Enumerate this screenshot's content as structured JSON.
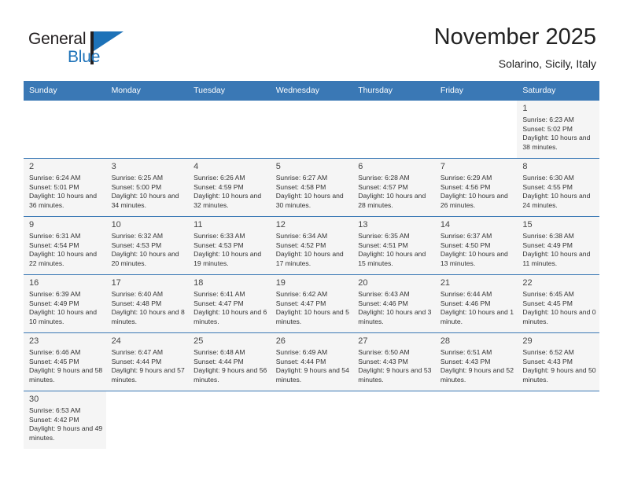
{
  "logo": {
    "word_top": "General",
    "word_bottom": "Blue",
    "brand_color": "#1d72b8",
    "text_color": "#231f20"
  },
  "header": {
    "title": "November 2025",
    "subtitle": "Solarino, Sicily, Italy"
  },
  "calendar": {
    "header_bg": "#3a78b5",
    "header_text_color": "#ffffff",
    "shaded_cell_bg": "#f5f5f5",
    "weekday_headers": [
      "Sunday",
      "Monday",
      "Tuesday",
      "Wednesday",
      "Thursday",
      "Friday",
      "Saturday"
    ],
    "weeks": [
      [
        {
          "day": "",
          "sunrise": "",
          "sunset": "",
          "daylight": "",
          "empty": true
        },
        {
          "day": "",
          "sunrise": "",
          "sunset": "",
          "daylight": "",
          "empty": true
        },
        {
          "day": "",
          "sunrise": "",
          "sunset": "",
          "daylight": "",
          "empty": true
        },
        {
          "day": "",
          "sunrise": "",
          "sunset": "",
          "daylight": "",
          "empty": true
        },
        {
          "day": "",
          "sunrise": "",
          "sunset": "",
          "daylight": "",
          "empty": true
        },
        {
          "day": "",
          "sunrise": "",
          "sunset": "",
          "daylight": "",
          "empty": true
        },
        {
          "day": "1",
          "sunrise": "Sunrise: 6:23 AM",
          "sunset": "Sunset: 5:02 PM",
          "daylight": "Daylight: 10 hours and 38 minutes.",
          "empty": false
        }
      ],
      [
        {
          "day": "2",
          "sunrise": "Sunrise: 6:24 AM",
          "sunset": "Sunset: 5:01 PM",
          "daylight": "Daylight: 10 hours and 36 minutes.",
          "empty": false
        },
        {
          "day": "3",
          "sunrise": "Sunrise: 6:25 AM",
          "sunset": "Sunset: 5:00 PM",
          "daylight": "Daylight: 10 hours and 34 minutes.",
          "empty": false
        },
        {
          "day": "4",
          "sunrise": "Sunrise: 6:26 AM",
          "sunset": "Sunset: 4:59 PM",
          "daylight": "Daylight: 10 hours and 32 minutes.",
          "empty": false
        },
        {
          "day": "5",
          "sunrise": "Sunrise: 6:27 AM",
          "sunset": "Sunset: 4:58 PM",
          "daylight": "Daylight: 10 hours and 30 minutes.",
          "empty": false
        },
        {
          "day": "6",
          "sunrise": "Sunrise: 6:28 AM",
          "sunset": "Sunset: 4:57 PM",
          "daylight": "Daylight: 10 hours and 28 minutes.",
          "empty": false
        },
        {
          "day": "7",
          "sunrise": "Sunrise: 6:29 AM",
          "sunset": "Sunset: 4:56 PM",
          "daylight": "Daylight: 10 hours and 26 minutes.",
          "empty": false
        },
        {
          "day": "8",
          "sunrise": "Sunrise: 6:30 AM",
          "sunset": "Sunset: 4:55 PM",
          "daylight": "Daylight: 10 hours and 24 minutes.",
          "empty": false
        }
      ],
      [
        {
          "day": "9",
          "sunrise": "Sunrise: 6:31 AM",
          "sunset": "Sunset: 4:54 PM",
          "daylight": "Daylight: 10 hours and 22 minutes.",
          "empty": false
        },
        {
          "day": "10",
          "sunrise": "Sunrise: 6:32 AM",
          "sunset": "Sunset: 4:53 PM",
          "daylight": "Daylight: 10 hours and 20 minutes.",
          "empty": false
        },
        {
          "day": "11",
          "sunrise": "Sunrise: 6:33 AM",
          "sunset": "Sunset: 4:53 PM",
          "daylight": "Daylight: 10 hours and 19 minutes.",
          "empty": false
        },
        {
          "day": "12",
          "sunrise": "Sunrise: 6:34 AM",
          "sunset": "Sunset: 4:52 PM",
          "daylight": "Daylight: 10 hours and 17 minutes.",
          "empty": false
        },
        {
          "day": "13",
          "sunrise": "Sunrise: 6:35 AM",
          "sunset": "Sunset: 4:51 PM",
          "daylight": "Daylight: 10 hours and 15 minutes.",
          "empty": false
        },
        {
          "day": "14",
          "sunrise": "Sunrise: 6:37 AM",
          "sunset": "Sunset: 4:50 PM",
          "daylight": "Daylight: 10 hours and 13 minutes.",
          "empty": false
        },
        {
          "day": "15",
          "sunrise": "Sunrise: 6:38 AM",
          "sunset": "Sunset: 4:49 PM",
          "daylight": "Daylight: 10 hours and 11 minutes.",
          "empty": false
        }
      ],
      [
        {
          "day": "16",
          "sunrise": "Sunrise: 6:39 AM",
          "sunset": "Sunset: 4:49 PM",
          "daylight": "Daylight: 10 hours and 10 minutes.",
          "empty": false
        },
        {
          "day": "17",
          "sunrise": "Sunrise: 6:40 AM",
          "sunset": "Sunset: 4:48 PM",
          "daylight": "Daylight: 10 hours and 8 minutes.",
          "empty": false
        },
        {
          "day": "18",
          "sunrise": "Sunrise: 6:41 AM",
          "sunset": "Sunset: 4:47 PM",
          "daylight": "Daylight: 10 hours and 6 minutes.",
          "empty": false
        },
        {
          "day": "19",
          "sunrise": "Sunrise: 6:42 AM",
          "sunset": "Sunset: 4:47 PM",
          "daylight": "Daylight: 10 hours and 5 minutes.",
          "empty": false
        },
        {
          "day": "20",
          "sunrise": "Sunrise: 6:43 AM",
          "sunset": "Sunset: 4:46 PM",
          "daylight": "Daylight: 10 hours and 3 minutes.",
          "empty": false
        },
        {
          "day": "21",
          "sunrise": "Sunrise: 6:44 AM",
          "sunset": "Sunset: 4:46 PM",
          "daylight": "Daylight: 10 hours and 1 minute.",
          "empty": false
        },
        {
          "day": "22",
          "sunrise": "Sunrise: 6:45 AM",
          "sunset": "Sunset: 4:45 PM",
          "daylight": "Daylight: 10 hours and 0 minutes.",
          "empty": false
        }
      ],
      [
        {
          "day": "23",
          "sunrise": "Sunrise: 6:46 AM",
          "sunset": "Sunset: 4:45 PM",
          "daylight": "Daylight: 9 hours and 58 minutes.",
          "empty": false
        },
        {
          "day": "24",
          "sunrise": "Sunrise: 6:47 AM",
          "sunset": "Sunset: 4:44 PM",
          "daylight": "Daylight: 9 hours and 57 minutes.",
          "empty": false
        },
        {
          "day": "25",
          "sunrise": "Sunrise: 6:48 AM",
          "sunset": "Sunset: 4:44 PM",
          "daylight": "Daylight: 9 hours and 56 minutes.",
          "empty": false
        },
        {
          "day": "26",
          "sunrise": "Sunrise: 6:49 AM",
          "sunset": "Sunset: 4:44 PM",
          "daylight": "Daylight: 9 hours and 54 minutes.",
          "empty": false
        },
        {
          "day": "27",
          "sunrise": "Sunrise: 6:50 AM",
          "sunset": "Sunset: 4:43 PM",
          "daylight": "Daylight: 9 hours and 53 minutes.",
          "empty": false
        },
        {
          "day": "28",
          "sunrise": "Sunrise: 6:51 AM",
          "sunset": "Sunset: 4:43 PM",
          "daylight": "Daylight: 9 hours and 52 minutes.",
          "empty": false
        },
        {
          "day": "29",
          "sunrise": "Sunrise: 6:52 AM",
          "sunset": "Sunset: 4:43 PM",
          "daylight": "Daylight: 9 hours and 50 minutes.",
          "empty": false
        }
      ],
      [
        {
          "day": "30",
          "sunrise": "Sunrise: 6:53 AM",
          "sunset": "Sunset: 4:42 PM",
          "daylight": "Daylight: 9 hours and 49 minutes.",
          "empty": false
        },
        {
          "day": "",
          "sunrise": "",
          "sunset": "",
          "daylight": "",
          "empty": true
        },
        {
          "day": "",
          "sunrise": "",
          "sunset": "",
          "daylight": "",
          "empty": true
        },
        {
          "day": "",
          "sunrise": "",
          "sunset": "",
          "daylight": "",
          "empty": true
        },
        {
          "day": "",
          "sunrise": "",
          "sunset": "",
          "daylight": "",
          "empty": true
        },
        {
          "day": "",
          "sunrise": "",
          "sunset": "",
          "daylight": "",
          "empty": true
        },
        {
          "day": "",
          "sunrise": "",
          "sunset": "",
          "daylight": "",
          "empty": true
        }
      ]
    ]
  }
}
